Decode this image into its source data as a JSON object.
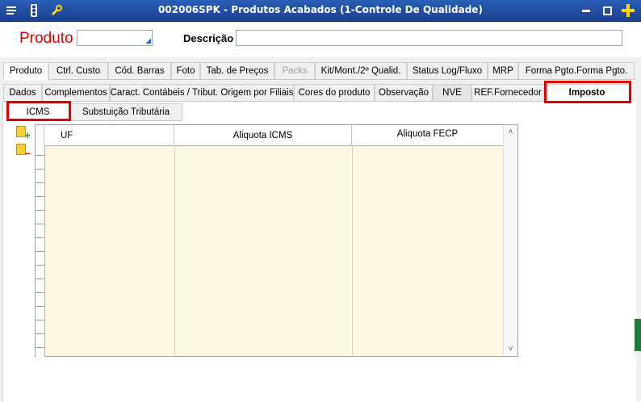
{
  "window": {
    "title": "002006SPK - Produtos Acabados (1-Controle De Qualidade)"
  },
  "header": {
    "produto_label": "Produto",
    "produto_value": "",
    "descricao_label": "Descrição",
    "descricao_value": ""
  },
  "tabs_main": [
    {
      "label": "Produto",
      "active": true
    },
    {
      "label": "Ctrl. Custo"
    },
    {
      "label": "Cód. Barras"
    },
    {
      "label": "Foto"
    },
    {
      "label": "Tab. de Preços"
    },
    {
      "label": "Packs",
      "disabled": true
    },
    {
      "label": "Kit/Mont./2º Qualid."
    },
    {
      "label": "Status Log/Fluxo"
    },
    {
      "label": "MRP"
    },
    {
      "label": "Forma Pgto.Forma Pgto."
    }
  ],
  "tabs_sub": [
    {
      "label": "Dados"
    },
    {
      "label": "Complementos"
    },
    {
      "label": "Caract. Contábeis / Tribut. Origem por Filiais"
    },
    {
      "label": "Cores do produto"
    },
    {
      "label": "Observação"
    },
    {
      "label": "NVE"
    },
    {
      "label": "REF.Fornecedor"
    },
    {
      "label": "Imposto",
      "active": true
    }
  ],
  "tabs_imposto": [
    {
      "label": "ICMS",
      "active": true
    },
    {
      "label": "Substuição Tributária"
    }
  ],
  "grid": {
    "columns": [
      "UF",
      "Aliquota ICMS",
      "Aliquota FECP"
    ],
    "rows": []
  },
  "icons": {
    "titlebar": [
      "menu-icon",
      "traffic-light-icon",
      "wrench-icon"
    ],
    "window": [
      "minimize-icon",
      "maximize-icon",
      "add-icon"
    ],
    "side": [
      "add-record-icon",
      "remove-record-icon"
    ]
  },
  "colors": {
    "titlebar": "#1b3f8f",
    "highlight": "#e00000",
    "grid_bg": "#fdf6e3",
    "produto_label": "#e00000"
  }
}
